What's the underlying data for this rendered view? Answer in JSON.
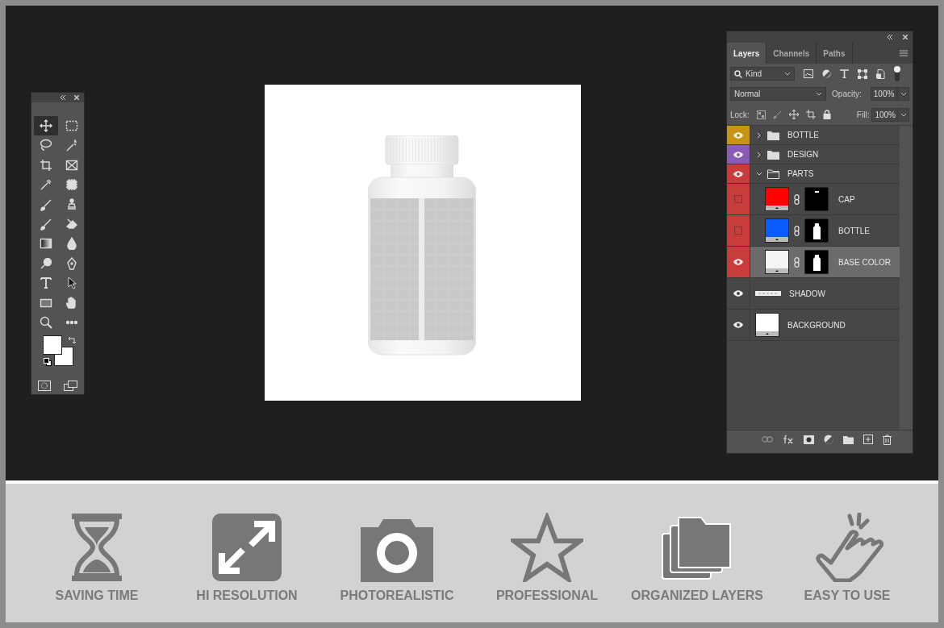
{
  "toolbox": {
    "tools": [
      {
        "kind": "move",
        "selected": true
      },
      {
        "kind": "marquee",
        "selected": false
      },
      {
        "kind": "lasso",
        "selected": false
      },
      {
        "kind": "wand",
        "selected": false
      },
      {
        "kind": "crop",
        "selected": false
      },
      {
        "kind": "frame",
        "selected": false
      },
      {
        "kind": "eyedropper",
        "selected": false
      },
      {
        "kind": "chip",
        "selected": false
      },
      {
        "kind": "brush",
        "selected": false
      },
      {
        "kind": "stamp",
        "selected": false
      },
      {
        "kind": "history",
        "selected": false
      },
      {
        "kind": "eraser",
        "selected": false
      },
      {
        "kind": "gradient",
        "selected": false
      },
      {
        "kind": "drop",
        "selected": false
      },
      {
        "kind": "dodge",
        "selected": false
      },
      {
        "kind": "pen",
        "selected": false
      },
      {
        "kind": "type",
        "selected": false
      },
      {
        "kind": "arrow",
        "selected": false
      },
      {
        "kind": "rectangle",
        "selected": false
      },
      {
        "kind": "hand",
        "selected": false
      },
      {
        "kind": "zoom",
        "selected": false
      },
      {
        "kind": "more",
        "selected": false
      }
    ]
  },
  "layers_panel": {
    "tabs": [
      {
        "label": "Layers",
        "selected": true
      },
      {
        "label": "Channels",
        "selected": false
      },
      {
        "label": "Paths",
        "selected": false
      }
    ],
    "filter": "Kind",
    "blend_mode": "Normal",
    "opacity_label": "Opacity:",
    "opacity": "100%",
    "lock_label": "Lock:",
    "fill_label": "Fill:",
    "fill": "100%",
    "layers": [
      {
        "kind": "group",
        "name": "BOTTLE",
        "visible": true,
        "color": "#c8960e",
        "expanded": false,
        "selected": false
      },
      {
        "kind": "group",
        "name": "DESIGN",
        "visible": true,
        "color": "#8a5bb5",
        "expanded": false,
        "selected": false
      },
      {
        "kind": "group",
        "name": "PARTS",
        "visible": true,
        "color": "#c83c3c",
        "expanded": true,
        "selected": false,
        "children": [
          {
            "kind": "masked",
            "name": "CAP",
            "visible": false,
            "color": "#ff0000",
            "selected": false
          },
          {
            "kind": "masked",
            "name": "BOTTLE",
            "visible": false,
            "color": "#0a5cff",
            "selected": false
          },
          {
            "kind": "masked",
            "name": "BASE COLOR",
            "visible": true,
            "color": "#f4f4f4",
            "selected": true
          }
        ]
      },
      {
        "kind": "shadow",
        "name": "SHADOW",
        "visible": true,
        "selected": false
      },
      {
        "kind": "plain",
        "name": "BACKGROUND",
        "visible": true,
        "selected": false
      }
    ]
  },
  "features": [
    {
      "kind": "hourglass",
      "label": "SAVING TIME"
    },
    {
      "kind": "expand",
      "label": "HI RESOLUTION"
    },
    {
      "kind": "camera",
      "label": "PHOTOREALISTIC"
    },
    {
      "kind": "star",
      "label": "PROFESSIONAL"
    },
    {
      "kind": "folders",
      "label": "ORGANIZED LAYERS"
    },
    {
      "kind": "hand",
      "label": "EASY TO USE"
    }
  ]
}
